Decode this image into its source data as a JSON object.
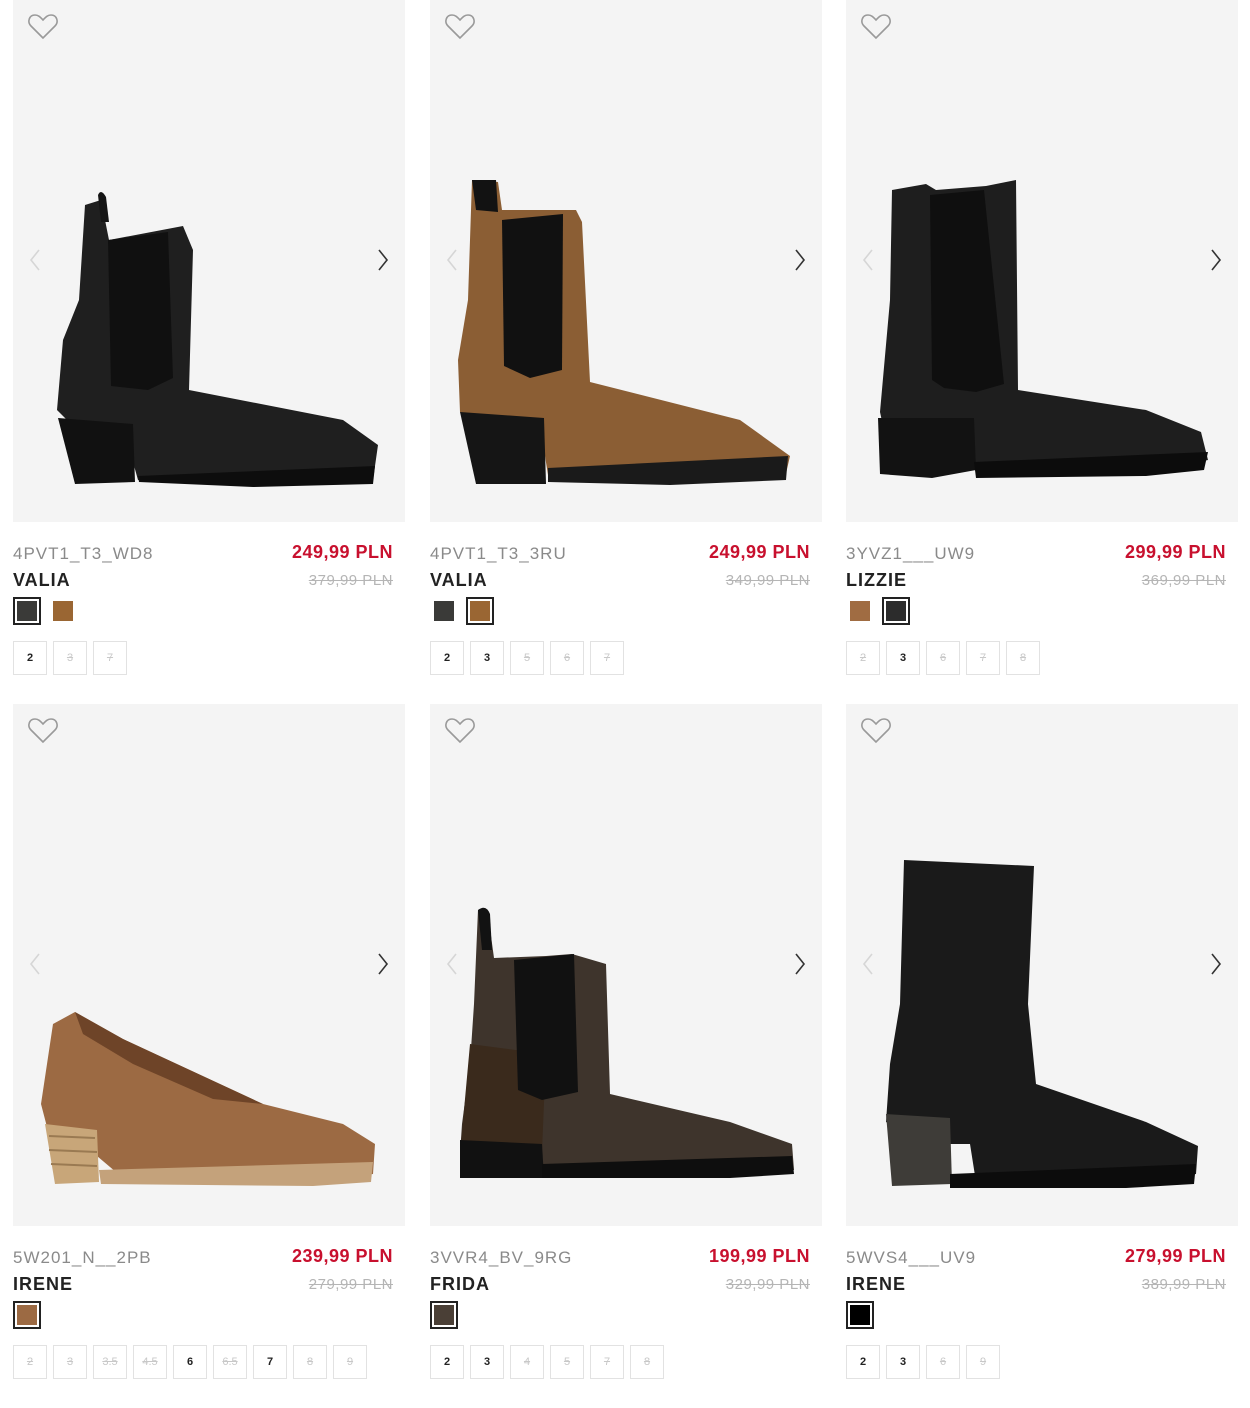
{
  "products": [
    {
      "code": "4PVT1_T3_WD8",
      "name": "VALIA",
      "price": "249,99 PLN",
      "old_price": "379,99 PLN",
      "swatches": [
        {
          "color": "#3a3a38",
          "selected": true
        },
        {
          "color": "#9a6633",
          "selected": false
        }
      ],
      "sizes": [
        {
          "label": "2",
          "available": true
        },
        {
          "label": "3",
          "available": false
        },
        {
          "label": "7",
          "available": false
        }
      ]
    },
    {
      "code": "4PVT1_T3_3RU",
      "name": "VALIA",
      "price": "249,99 PLN",
      "old_price": "349,99 PLN",
      "swatches": [
        {
          "color": "#3a3a38",
          "selected": false
        },
        {
          "color": "#9a6633",
          "selected": true
        }
      ],
      "sizes": [
        {
          "label": "2",
          "available": true
        },
        {
          "label": "3",
          "available": true
        },
        {
          "label": "5",
          "available": false
        },
        {
          "label": "6",
          "available": false
        },
        {
          "label": "7",
          "available": false
        }
      ]
    },
    {
      "code": "3YVZ1___UW9",
      "name": "LIZZIE",
      "price": "299,99 PLN",
      "old_price": "369,99 PLN",
      "swatches": [
        {
          "color": "#a06c42",
          "selected": false
        },
        {
          "color": "#2c2c2c",
          "selected": true
        }
      ],
      "sizes": [
        {
          "label": "2",
          "available": false
        },
        {
          "label": "3",
          "available": true
        },
        {
          "label": "6",
          "available": false
        },
        {
          "label": "7",
          "available": false
        },
        {
          "label": "8",
          "available": false
        }
      ]
    },
    {
      "code": "5W201_N__2PB",
      "name": "IRENE",
      "price": "239,99 PLN",
      "old_price": "279,99 PLN",
      "swatches": [
        {
          "color": "#9c6a43",
          "selected": true
        }
      ],
      "sizes": [
        {
          "label": "2",
          "available": false
        },
        {
          "label": "3",
          "available": false
        },
        {
          "label": "3.5",
          "available": false
        },
        {
          "label": "4.5",
          "available": false
        },
        {
          "label": "6",
          "available": true
        },
        {
          "label": "6.5",
          "available": false
        },
        {
          "label": "7",
          "available": true
        },
        {
          "label": "8",
          "available": false
        },
        {
          "label": "9",
          "available": false
        }
      ]
    },
    {
      "code": "3VVR4_BV_9RG",
      "name": "FRIDA",
      "price": "199,99 PLN",
      "old_price": "329,99 PLN",
      "swatches": [
        {
          "color": "#4a3f36",
          "selected": true
        }
      ],
      "sizes": [
        {
          "label": "2",
          "available": true
        },
        {
          "label": "3",
          "available": true
        },
        {
          "label": "4",
          "available": false
        },
        {
          "label": "5",
          "available": false
        },
        {
          "label": "7",
          "available": false
        },
        {
          "label": "8",
          "available": false
        }
      ]
    },
    {
      "code": "5WVS4___UV9",
      "name": "IRENE",
      "price": "279,99 PLN",
      "old_price": "389,99 PLN",
      "swatches": [
        {
          "color": "#000000",
          "selected": true
        }
      ],
      "sizes": [
        {
          "label": "2",
          "available": true
        },
        {
          "label": "3",
          "available": true
        },
        {
          "label": "6",
          "available": false
        },
        {
          "label": "9",
          "available": false
        }
      ]
    }
  ],
  "icons": {
    "favorite": "heart-outline-icon",
    "previous": "chevron-left-icon",
    "next": "chevron-right-icon"
  }
}
